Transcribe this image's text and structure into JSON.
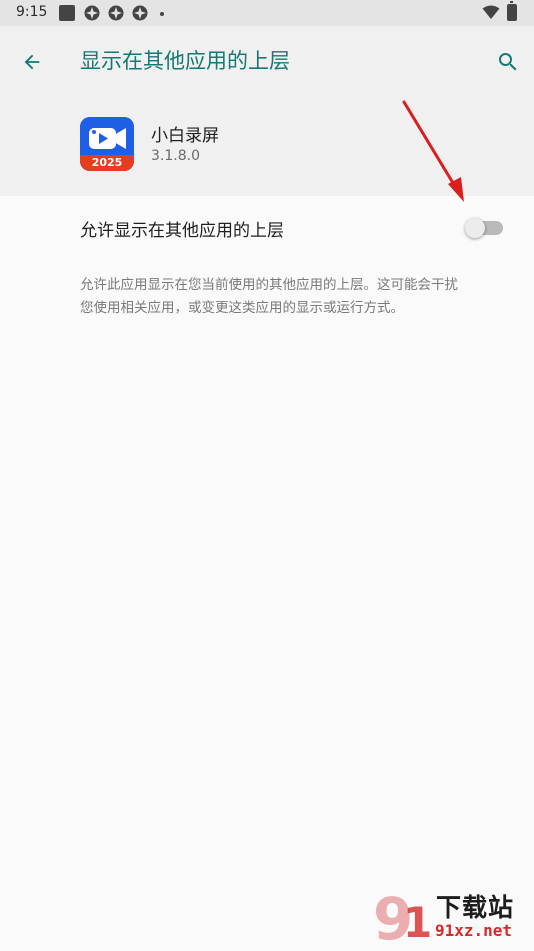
{
  "status_bar": {
    "time": "9:15",
    "icons": [
      "screenshot-notification-icon",
      "app-notification-icon",
      "app-notification-icon",
      "app-notification-icon",
      "more-notifications-dot",
      "wifi-icon",
      "battery-icon"
    ]
  },
  "app_bar": {
    "title": "显示在其他应用的上层",
    "back_icon": "arrow-back-icon",
    "search_icon": "search-icon",
    "accent_color": "#127a72"
  },
  "app_info": {
    "name": "小白录屏",
    "version": "3.1.8.0",
    "icon_badge": "2025"
  },
  "setting": {
    "label": "允许显示在其他应用的上层",
    "enabled": false
  },
  "description": {
    "line1": "允许此应用显示在您当前使用的其他应用的上层。这可能会干扰",
    "line2": "您使用相关应用，或变更这类应用的显示或运行方式。"
  },
  "annotation": {
    "arrow_color": "#d91e1e"
  },
  "watermark": {
    "text": "下载站",
    "url": "91xz.net"
  }
}
